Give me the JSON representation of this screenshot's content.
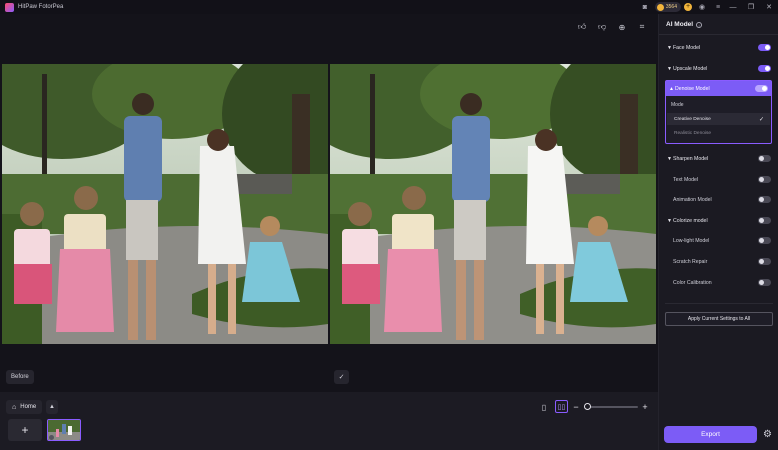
{
  "app": {
    "title": "HitPaw FotorPea",
    "credits": "3564"
  },
  "titlebar_icons": [
    "discord-icon",
    "coin-plus-icon",
    "account-icon",
    "menu-icon"
  ],
  "window_controls": [
    "minimize",
    "restore",
    "close"
  ],
  "toolbar": {
    "icons": [
      "thumbs-up-icon",
      "thumbs-down-icon",
      "zoom-in-icon",
      "crop-icon"
    ]
  },
  "canvas": {
    "before_label": "Before",
    "check_symbol": "✓"
  },
  "bottom": {
    "home_label": "Home",
    "add_symbol": "+",
    "zoom_minus": "−",
    "zoom_plus": "+"
  },
  "panel": {
    "title": "AI Model",
    "models": [
      {
        "label": "Face Model",
        "on": true,
        "expandable": true
      },
      {
        "label": "Upscale Model",
        "on": true,
        "expandable": true
      },
      {
        "label": "Denoise Model",
        "on": true,
        "expandable": true,
        "active": true
      },
      {
        "label": "Sharpen Model",
        "on": false,
        "expandable": true
      },
      {
        "label": "Text Model",
        "on": false,
        "expandable": false
      },
      {
        "label": "Animation Model",
        "on": false,
        "expandable": false
      },
      {
        "label": "Colorize model",
        "on": false,
        "expandable": true
      },
      {
        "label": "Low-light Model",
        "on": false,
        "expandable": false
      },
      {
        "label": "Scratch Repair",
        "on": false,
        "expandable": false
      },
      {
        "label": "Color Calibration",
        "on": false,
        "expandable": false
      }
    ],
    "denoise": {
      "mode_label": "Mode",
      "options": [
        "Creative Denoise",
        "Realistic Denoise"
      ],
      "selected": "Creative Denoise"
    },
    "apply_label": "Apply Current Settings to All",
    "export_label": "Export"
  },
  "colors": {
    "accent": "#7c5cf6",
    "background": "#16151c",
    "panel": "#1b1a22"
  }
}
